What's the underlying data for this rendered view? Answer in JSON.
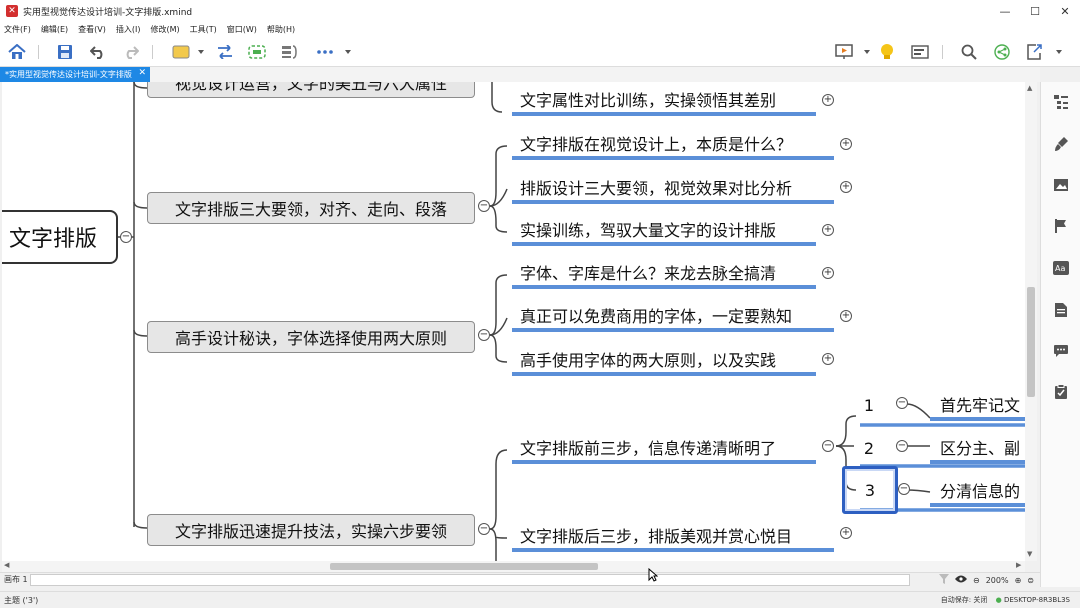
{
  "window": {
    "title": "实用型视觉传达设计培训-文字排版.xmind",
    "controls": {
      "minimize": "—",
      "maximize": "☐",
      "close": "✕"
    }
  },
  "menu": [
    "文件(F)",
    "编辑(E)",
    "查看(V)",
    "插入(I)",
    "修改(M)",
    "工具(T)",
    "窗口(W)",
    "帮助(H)"
  ],
  "toolbar": {
    "icons": [
      "home-icon",
      "save-icon",
      "undo-icon",
      "redo-icon",
      "topic-icon",
      "relationship-icon",
      "boundary-icon",
      "summary-icon",
      "more-icon",
      "presentation-icon",
      "idea-icon",
      "outline-icon",
      "search-icon",
      "share-icon",
      "export-icon"
    ]
  },
  "tab": {
    "label": "*实用型视觉传达设计培训-文字排版",
    "close": "✕"
  },
  "mindmap": {
    "root": "文字排版",
    "branches": [
      {
        "label": "视觉设计运营，文字的美丑与六大属性",
        "children": [
          "文字属性对比训练，实操领悟其差别"
        ]
      },
      {
        "label": "文字排版三大要领，对齐、走向、段落",
        "children": [
          "文字排版在视觉设计上，本质是什么？",
          "排版设计三大要领，视觉效果对比分析",
          "实操训练，驾驭大量文字的设计排版"
        ]
      },
      {
        "label": "高手设计秘诀，字体选择使用两大原则",
        "children": [
          "字体、字库是什么？来龙去脉全搞清",
          "真正可以免费商用的字体，一定要熟知",
          "高手使用字体的两大原则，以及实践"
        ]
      },
      {
        "label": "文字排版迅速提升技法，实操六步要领",
        "children": [
          {
            "label": "文字排版前三步，信息传递清晰明了",
            "steps": [
              {
                "num": "1",
                "text": "首先牢记文"
              },
              {
                "num": "2",
                "text": "区分主、副"
              },
              {
                "num": "3",
                "text": "分清信息的"
              }
            ]
          },
          {
            "label": "文字排版后三步，排版美观并赏心悦目"
          }
        ]
      }
    ],
    "expand_symbol": "+",
    "collapse_symbol": "−"
  },
  "sheet": {
    "name": "画布 1"
  },
  "zoom": {
    "level": "200%"
  },
  "status": {
    "selection": "主题 ('3')",
    "autosave": "自动保存: 关闭",
    "computer": "DESKTOP-8R3BL3S"
  },
  "colors": {
    "accent": "#1e88e5",
    "underline": "#5b8fd8",
    "selection": "#2d5fc1",
    "branch_fill": "#e6e6e6"
  }
}
